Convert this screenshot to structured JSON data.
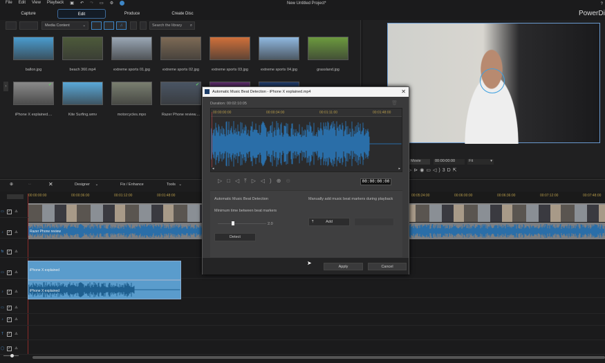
{
  "menu": {
    "items": [
      "File",
      "Edit",
      "View",
      "Playback"
    ],
    "project_title": "New Untitled Project*",
    "brand": "PowerDi",
    "help": "?"
  },
  "tabs": [
    {
      "label": "Capture"
    },
    {
      "label": "Edit",
      "active": true
    },
    {
      "label": "Produce"
    },
    {
      "label": "Create Disc"
    }
  ],
  "library": {
    "filter": "Media Content",
    "search_placeholder": "Search the library",
    "items": [
      {
        "name": "ballon.jpg",
        "color": "#4a9ccf"
      },
      {
        "name": "beach 360.mp4",
        "color": "#4d5a3a"
      },
      {
        "name": "extreme sports 01.jpg",
        "color": "#9aa7b5"
      },
      {
        "name": "extreme sports 02.jpg",
        "color": "#7d6a55"
      },
      {
        "name": "extreme sports 03.jpg",
        "color": "#d0703a"
      },
      {
        "name": "extreme sports 04.jpg",
        "color": "#8fb8e0"
      },
      {
        "name": "grassland.jpg",
        "color": "#6c9a3e"
      },
      {
        "name": "iPhone X explained....",
        "color": "#8a8a8a",
        "check": true
      },
      {
        "name": "Kite Surfing.wmv",
        "color": "#5aa8d8"
      },
      {
        "name": "motorcycles.mpo",
        "color": "#7a7f70"
      },
      {
        "name": "Razer Phone review....",
        "color": "#4a5564",
        "check": true
      },
      {
        "name": "",
        "color": "#5a2a6a"
      },
      {
        "name": "",
        "color": "#1e3a6a"
      }
    ]
  },
  "preview": {
    "mode": "Movie",
    "timecode": "00:00:00:00",
    "fit": "Fit",
    "threed": "3D"
  },
  "timeline": {
    "toolbar": {
      "designer": "Designer",
      "fix": "Fix / Enhance",
      "tools": "Tools"
    },
    "ruler": [
      "00:00:00:00",
      "00:00:36:00",
      "00:01:12:00",
      "00:01:48:00"
    ],
    "ruler_right": [
      "00:05:24:00",
      "00:06:00:00",
      "00:06:36:00",
      "00:07:12:00",
      "00:07:48:00"
    ],
    "clips": {
      "video1_audio": "Razer Phone review",
      "video2": "iPhone X explained",
      "audio2": "iPhone X explained"
    }
  },
  "dialog": {
    "title": "Automatic Music Beat Detection - iPhone X explained.mp4",
    "duration": "Duration: 00:02:10:05",
    "ruler": [
      "00:00:00:00",
      "00:00:34:00",
      "00:01:11:00",
      "00:01:48:00"
    ],
    "timecode": "00:00:00:00",
    "auto_title": "Automatic Music Beat Detection",
    "min_time_label": "Minimum time between beat markers",
    "min_time_value": "2.0",
    "detect": "Detect",
    "manual_title": "Manually add music beat markers during playback",
    "add": "Add",
    "apply": "Apply",
    "cancel": "Cancel"
  },
  "colors": {
    "accent": "#3e86c6",
    "waveform": "#2a6ea8",
    "ruler_text": "#b59a4a"
  }
}
